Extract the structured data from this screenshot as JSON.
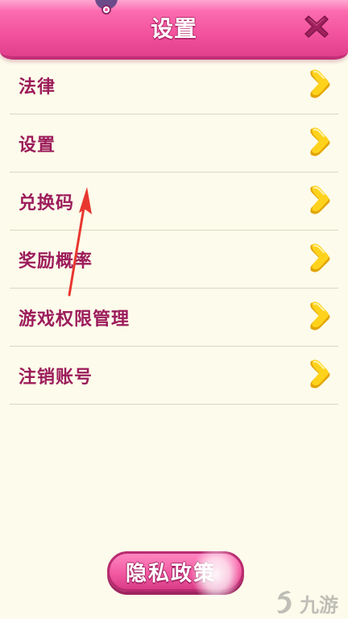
{
  "header": {
    "title": "设置"
  },
  "menu": {
    "items": [
      {
        "label": "法律"
      },
      {
        "label": "设置"
      },
      {
        "label": "兑换码"
      },
      {
        "label": "奖励概率"
      },
      {
        "label": "游戏权限管理"
      },
      {
        "label": "注销账号"
      }
    ]
  },
  "privacy_button": {
    "label": "隐私政策"
  },
  "watermark": {
    "text": "九游"
  },
  "icons": {
    "close": "close-icon",
    "chevron": "chevron-right-icon",
    "avatar": "avatar"
  },
  "colors": {
    "header_pink": "#f4569f",
    "label_magenta": "#9c1c5b",
    "chevron_yellow": "#ffd21c",
    "background": "#fdfbeb",
    "annotation_red": "#e8372f"
  }
}
